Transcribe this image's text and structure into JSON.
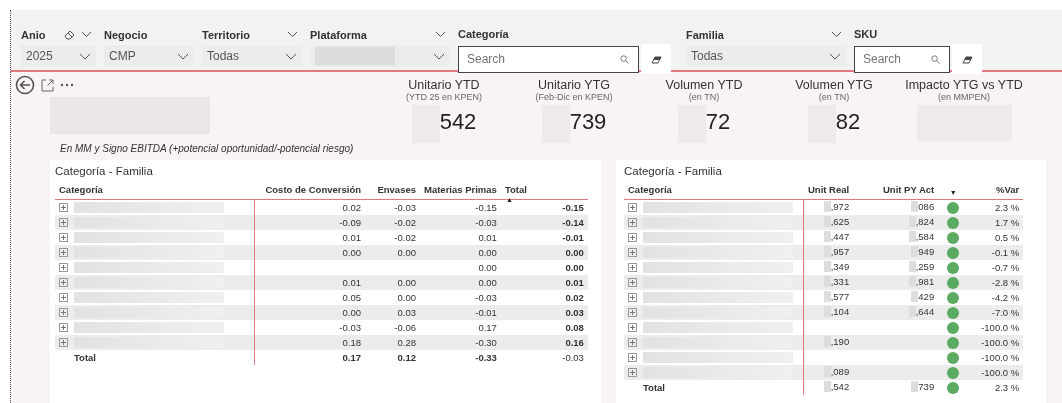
{
  "filters": [
    {
      "label": "Anio",
      "kind": "dropdown",
      "value": "2025",
      "eraser": true,
      "header_chevron": true
    },
    {
      "label": "Negocio",
      "kind": "dropdown",
      "value": "CMP",
      "eraser": false,
      "header_chevron": false
    },
    {
      "label": "Territorio",
      "kind": "dropdown",
      "value": "Todas",
      "eraser": false,
      "header_chevron": true
    },
    {
      "label": "Plataforma",
      "kind": "dropdown",
      "eraser": false,
      "header_chevron": true
    },
    {
      "label": "Categoría",
      "kind": "search",
      "placeholder": "Search"
    },
    {
      "label": "Familia",
      "kind": "dropdown",
      "value": "Todas",
      "eraser": false,
      "header_chevron": true
    },
    {
      "label": "SKU",
      "kind": "search",
      "placeholder": "Search"
    }
  ],
  "note": "En MM y Signo EBITDA (+potencial oportunidad/-potencial riesgo)",
  "kpis": [
    {
      "title": "Unitario YTD",
      "subtitle": "(YTD 25 en KPEN)",
      "value": "542"
    },
    {
      "title": "Unitario YTG",
      "subtitle": "(Feb-Dic en KPEN)",
      "value": "739"
    },
    {
      "title": "Volumen YTD",
      "subtitle": "(en TN)",
      "value": "72"
    },
    {
      "title": "Volumen YTG",
      "subtitle": "(en TN)",
      "value": "82"
    },
    {
      "title": "Impacto YTG vs YTD",
      "subtitle": "(en MMPEN)"
    }
  ],
  "left_table": {
    "title": "Categoría - Familia",
    "columns": [
      {
        "label": "Categoría"
      },
      {
        "label": "Costo de Conversión"
      },
      {
        "label": "Envases"
      },
      {
        "label": "Materias Primas"
      },
      {
        "label": "Total",
        "sort_arrow": "▲"
      }
    ],
    "rows": [
      {
        "costo_conversion": "0.02",
        "envases": "-0.03",
        "materias_primas": "-0.15",
        "total": "-0.15"
      },
      {
        "costo_conversion": "-0.09",
        "envases": "-0.02",
        "materias_primas": "-0.03",
        "total": "-0.14"
      },
      {
        "costo_conversion": "0.01",
        "envases": "-0.02",
        "materias_primas": "0.01",
        "total": "-0.01"
      },
      {
        "costo_conversion": "0.00",
        "envases": "0.00",
        "materias_primas": "0.00",
        "total": "0.00"
      },
      {
        "materias_primas": "0.00",
        "total": "0.00"
      },
      {
        "costo_conversion": "0.01",
        "envases": "0.00",
        "materias_primas": "0.00",
        "total": "0.01"
      },
      {
        "costo_conversion": "0.05",
        "envases": "0.00",
        "materias_primas": "-0.03",
        "total": "0.02"
      },
      {
        "costo_conversion": "0.00",
        "envases": "0.03",
        "materias_primas": "-0.01",
        "total": "0.03"
      },
      {
        "costo_conversion": "-0.03",
        "envases": "-0.06",
        "materias_primas": "0.17",
        "total": "0.08"
      },
      {
        "costo_conversion": "0.18",
        "envases": "0.28",
        "materias_primas": "-0.30",
        "total": "0.16"
      }
    ],
    "total": {
      "label": "Total",
      "costo_conversion": "0.17",
      "envases": "0.12",
      "materias_primas": "-0.33",
      "total": "-0.03"
    }
  },
  "right_table": {
    "title": "Categoría - Familia",
    "columns": [
      {
        "label": "Categoría"
      },
      {
        "label": "Unit Real"
      },
      {
        "label": "Unit PY Act"
      },
      {
        "sort_arrow": "▼"
      },
      {
        "label": "%Var"
      }
    ],
    "rows": [
      {
        "unit_real": ",972",
        "unit_py": "086",
        "color": "#5aaa62",
        "var": "2.3 %"
      },
      {
        "unit_real": ",625",
        "unit_py": ",824",
        "color": "#5aaa62",
        "var": "1.7 %"
      },
      {
        "unit_real": ",447",
        "unit_py": ",584",
        "color": "#5aaa62",
        "var": "0.5 %"
      },
      {
        "unit_real": ",957",
        "unit_py": "949",
        "color": "#5aaa62",
        "var": "-0.1 %"
      },
      {
        "unit_real": ",349",
        "unit_py": ",259",
        "color": "#5aaa62",
        "var": "-0.7 %"
      },
      {
        "unit_real": ",331",
        "unit_py": ",981",
        "color": "#5aaa62",
        "var": "-2.8 %"
      },
      {
        "unit_real": ",577",
        "unit_py": "429",
        "color": "#5aaa62",
        "var": "-4.2 %"
      },
      {
        "unit_real": ",104",
        "unit_py": ",644",
        "color": "#5aaa62",
        "var": "-7.0 %"
      },
      {
        "color": "#5aaa62",
        "var": "-100.0 %"
      },
      {
        "unit_real": ",190",
        "color": "#5aaa62",
        "var": "-100.0 %"
      },
      {
        "color": "#5aaa62",
        "var": "-100.0 %"
      },
      {
        "unit_real": ",089",
        "color": "#5aaa62",
        "var": "-100.0 %"
      }
    ],
    "total": {
      "label": "Total",
      "unit_real": ",542",
      "unit_py": "739",
      "color": "#5aaa62",
      "var": "2.3 %"
    }
  }
}
